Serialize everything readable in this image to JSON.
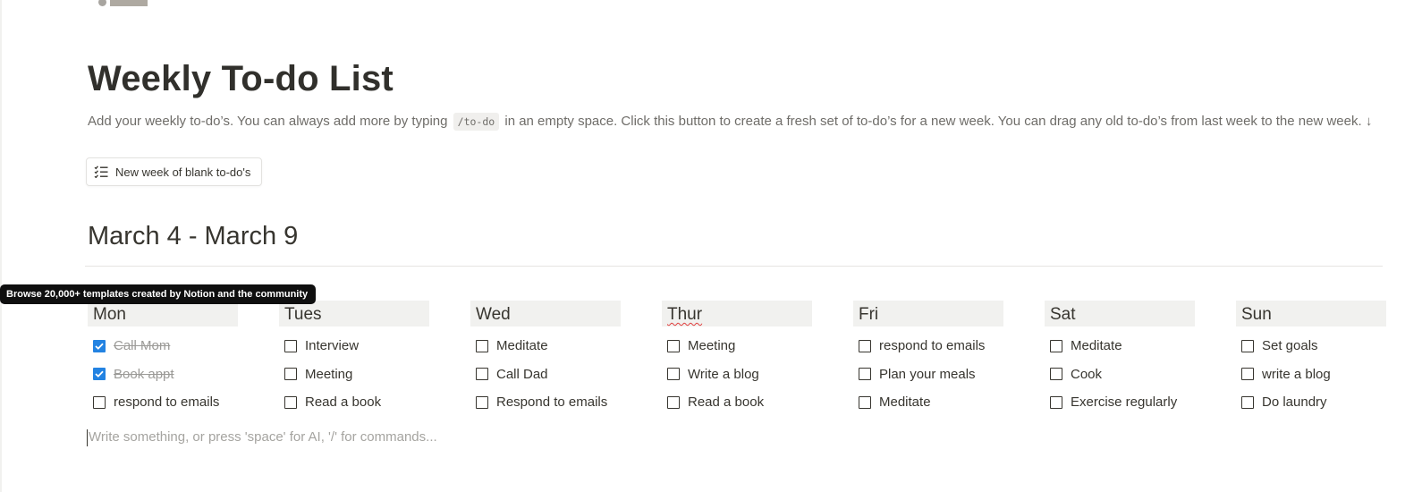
{
  "page": {
    "title": "Weekly To-do List",
    "description_before_code": "Add your weekly to-do’s. You can always add more by typing ",
    "description_code": "/to-do",
    "description_after_code": " in an empty space. Click this button to create a fresh set of to-do’s for a new week. You can drag any old to-do’s from last week to the new week. ↓",
    "button": {
      "label": "New week of blank to-do's",
      "icon": "checklist-icon"
    },
    "week_heading": "March 4 - March 9",
    "tooltip": "Browse 20,000+ templates created by Notion and the community",
    "placeholder": "Write something, or press 'space' for AI, '/' for commands..."
  },
  "colors": {
    "checkbox_checked": "#2383e2",
    "day_header_bg": "#f1f1ef",
    "text": "#37352f",
    "muted_text": "#9b9a97",
    "tooltip_bg": "#0f0f0f",
    "spellcheck_underline": "#e03e3e"
  },
  "days": [
    {
      "name": "Mon",
      "misspelled": false,
      "todos": [
        {
          "text": "Call Mom",
          "checked": true
        },
        {
          "text": "Book appt",
          "checked": true
        },
        {
          "text": "respond to emails",
          "checked": false
        }
      ]
    },
    {
      "name": "Tues",
      "misspelled": false,
      "todos": [
        {
          "text": "Interview",
          "checked": false
        },
        {
          "text": "Meeting",
          "checked": false
        },
        {
          "text": "Read a book",
          "checked": false
        }
      ]
    },
    {
      "name": "Wed",
      "misspelled": false,
      "todos": [
        {
          "text": "Meditate",
          "checked": false
        },
        {
          "text": "Call Dad",
          "checked": false
        },
        {
          "text": "Respond to emails",
          "checked": false
        }
      ]
    },
    {
      "name": "Thur",
      "misspelled": true,
      "todos": [
        {
          "text": "Meeting",
          "checked": false
        },
        {
          "text": "Write a blog",
          "checked": false
        },
        {
          "text": "Read a book",
          "checked": false
        }
      ]
    },
    {
      "name": "Fri",
      "misspelled": false,
      "todos": [
        {
          "text": "respond to emails",
          "checked": false
        },
        {
          "text": "Plan your meals",
          "checked": false
        },
        {
          "text": "Meditate",
          "checked": false
        }
      ]
    },
    {
      "name": "Sat",
      "misspelled": false,
      "todos": [
        {
          "text": "Meditate",
          "checked": false
        },
        {
          "text": "Cook",
          "checked": false
        },
        {
          "text": "Exercise regularly",
          "checked": false
        }
      ]
    },
    {
      "name": "Sun",
      "misspelled": false,
      "todos": [
        {
          "text": "Set goals",
          "checked": false
        },
        {
          "text": "write a blog",
          "checked": false
        },
        {
          "text": "Do laundry",
          "checked": false
        }
      ]
    }
  ]
}
